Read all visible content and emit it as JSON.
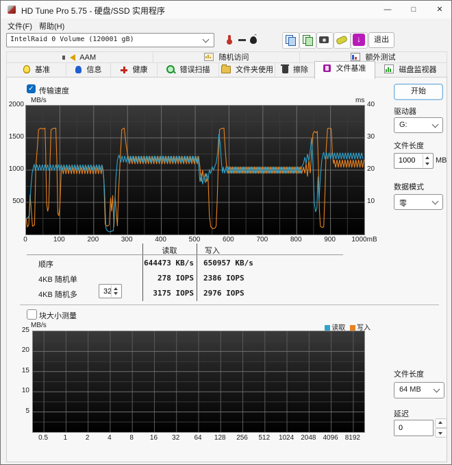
{
  "window": {
    "title": "HD Tune Pro 5.75 - 硬盘/SSD 实用程序",
    "minimize": "—",
    "maximize": "□",
    "close": "✕"
  },
  "menu": {
    "file": "文件(F)",
    "help": "帮助(H)"
  },
  "toolbar": {
    "drive_combo": "IntelRaid 0 Volume (120001 gB)",
    "exit": "退出"
  },
  "tabs": {
    "row1": [
      {
        "label": "AAM"
      },
      {
        "label": "随机访问"
      },
      {
        "label": "额外测试"
      }
    ],
    "row2": [
      {
        "label": "基准"
      },
      {
        "label": "信息"
      },
      {
        "label": "健康"
      },
      {
        "label": "错误扫描"
      },
      {
        "label": "文件夹使用"
      },
      {
        "label": "擦除"
      },
      {
        "label": "文件基准",
        "active": true
      },
      {
        "label": "磁盘监视器"
      }
    ]
  },
  "controls": {
    "transfer_speed": "传输速度",
    "block_size": "块大小测量",
    "check_glyph": "✓",
    "start": "开始",
    "drive_label": "驱动器",
    "drive_value": "G:",
    "file_length_label": "文件长度",
    "file_length_value": "1000",
    "file_length_unit": "MB",
    "data_mode_label": "数据模式",
    "data_mode_value": "零",
    "file_length2_label": "文件长度",
    "file_length2_value": "64 MB",
    "delay_label": "延迟",
    "delay_value": "0",
    "multi_queue_value": "32"
  },
  "results": {
    "read_header": "读取",
    "write_header": "写入",
    "rows": [
      {
        "label": "顺序",
        "read": "644473 KB/s",
        "write": "650957 KB/s"
      },
      {
        "label": "4KB 随机单",
        "read": "278 IOPS",
        "write": "2386 IOPS"
      },
      {
        "label": "4KB 随机多",
        "read": "3175 IOPS",
        "write": "2976 IOPS"
      }
    ]
  },
  "colors": {
    "read": "#2fa3cc",
    "write": "#e8821e"
  },
  "chart_data": [
    {
      "type": "line",
      "title": "传输速度",
      "ylabel": "MB/s",
      "ylabel_right": "ms",
      "xlim": [
        0,
        1000
      ],
      "ylim": [
        0,
        2000
      ],
      "ylim_right": [
        0,
        40
      ],
      "yticks": [
        2000,
        1500,
        1000,
        500
      ],
      "yticks_right": [
        40,
        30,
        20,
        10
      ],
      "xticks": [
        0,
        100,
        200,
        300,
        400,
        500,
        600,
        700,
        800,
        900
      ],
      "xtick_last": "1000mB",
      "grid": {
        "x_minor": 50,
        "x_major": 100,
        "y_minor": 250,
        "y_major": 500
      },
      "series": [
        {
          "name": "写入",
          "color": "#e8821e",
          "segments": [
            {
              "p": [
                [
                  0,
                  260
                ],
                [
                  4,
                  120
                ],
                [
                  8,
                  150
                ],
                [
                  12,
                  620
                ],
                [
                  15,
                  420
                ],
                [
                  19,
                  130
                ],
                [
                  25,
                  150
                ],
                [
                  29,
                  1050
                ],
                [
                  33,
                  1320
                ],
                [
                  37,
                  1630
                ],
                [
                  44,
                  1650
                ],
                [
                  50,
                  1635
                ],
                [
                  56,
                  1650
                ],
                [
                  58,
                  1280
                ],
                [
                  61,
                  480
                ],
                [
                  64,
                  360
                ],
                [
                  67,
                  430
                ],
                [
                  70,
                  1000
                ],
                [
                  74,
                  1630
                ],
                [
                  80,
                  1645
                ],
                [
                  88,
                  1650
                ],
                [
                  91,
                  1150
                ],
                [
                  94,
                  330
                ],
                [
                  97,
                  290
                ],
                [
                  100,
                  430
                ],
                [
                  104,
                  990
                ]
              ]
            },
            {
              "o": [
                106,
                228,
                1000,
                60,
                4
              ]
            },
            {
              "p": [
                [
                  230,
                  870
                ],
                [
                  234,
                  160
                ],
                [
                  240,
                  130
                ],
                [
                  246,
                  150
                ],
                [
                  250,
                  570
                ],
                [
                  253,
                  360
                ],
                [
                  256,
                  610
                ],
                [
                  260,
                  120
                ],
                [
                  263,
                  590
                ],
                [
                  266,
                  410
                ],
                [
                  270,
                  130
                ],
                [
                  274,
                  720
                ],
                [
                  278,
                  1120
                ],
                [
                  283,
                  1630
                ],
                [
                  290,
                  1650
                ],
                [
                  295,
                  1430
                ],
                [
                  300,
                  1240
                ]
              ]
            },
            {
              "o": [
                302,
                512,
                1155,
                60,
                4
              ]
            },
            {
              "p": [
                [
                  514,
                  1050
                ],
                [
                  518,
                  820
                ],
                [
                  522,
                  1000
                ],
                [
                  526,
                  860
                ],
                [
                  530,
                  950
                ],
                [
                  534,
                  820
                ],
                [
                  538,
                  900
                ],
                [
                  542,
                  300
                ],
                [
                  546,
                  120
                ],
                [
                  552,
                  90
                ],
                [
                  558,
                  100
                ],
                [
                  562,
                  130
                ],
                [
                  565,
                  520
                ],
                [
                  568,
                  1050
                ],
                [
                  572,
                  1630
                ],
                [
                  578,
                  1645
                ],
                [
                  585,
                  1650
                ],
                [
                  589,
                  1300
                ],
                [
                  593,
                  1050
                ]
              ]
            },
            {
              "o": [
                595,
                818,
                1000,
                55,
                4
              ]
            },
            {
              "p": [
                [
                  820,
                  1050
                ],
                [
                  824,
                  950
                ],
                [
                  828,
                  1100
                ],
                [
                  832,
                  900
                ],
                [
                  836,
                  1150
                ],
                [
                  840,
                  950
                ],
                [
                  844,
                  1250
                ],
                [
                  848,
                  1560
                ],
                [
                  852,
                  1600
                ],
                [
                  857,
                  1580
                ],
                [
                  861,
                  1600
                ],
                [
                  864,
                  1100
                ],
                [
                  867,
                  400
                ],
                [
                  870,
                  130
                ],
                [
                  875,
                  110
                ],
                [
                  880,
                  120
                ],
                [
                  884,
                  700
                ],
                [
                  887,
                  1300
                ],
                [
                  891,
                  1640
                ],
                [
                  896,
                  1650
                ],
                [
                  902,
                  1640
                ],
                [
                  905,
                  1300
                ],
                [
                  909,
                  1100
                ]
              ]
            },
            {
              "o": [
                911,
                999,
                1100,
                60,
                4
              ]
            }
          ]
        },
        {
          "name": "读取",
          "color": "#2fa3cc",
          "segments": [
            {
              "p": [
                [
                  0,
                  240
                ],
                [
                  5,
                  260
                ],
                [
                  10,
                  300
                ],
                [
                  14,
                  700
                ],
                [
                  18,
                  950
                ],
                [
                  22,
                  1050
                ]
              ]
            },
            {
              "o": [
                24,
                226,
                1040,
                45,
                4
              ]
            },
            {
              "p": [
                [
                  228,
                  1000
                ],
                [
                  232,
                  700
                ],
                [
                  236,
                  100
                ],
                [
                  240,
                  60
                ],
                [
                  246,
                  40
                ],
                [
                  252,
                  50
                ],
                [
                  258,
                  60
                ],
                [
                  262,
                  400
                ],
                [
                  266,
                  900
                ],
                [
                  270,
                  1150
                ],
                [
                  274,
                  1230
                ]
              ]
            },
            {
              "o": [
                276,
                508,
                1170,
                50,
                4
              ]
            },
            {
              "p": [
                [
                  510,
                  1100
                ],
                [
                  514,
                  820
                ],
                [
                  518,
                  950
                ],
                [
                  522,
                  780
                ],
                [
                  526,
                  900
                ],
                [
                  530,
                  800
                ],
                [
                  534,
                  950
                ],
                [
                  538,
                  850
                ],
                [
                  542,
                  1000
                ],
                [
                  546,
                  950
                ],
                [
                  550,
                  1050
                ],
                [
                  554,
                  1000
                ],
                [
                  558,
                  1060
                ],
                [
                  562,
                  1110
                ],
                [
                  566,
                  1250
                ],
                [
                  570,
                  1560
                ],
                [
                  574,
                  1400
                ],
                [
                  578,
                  1100
                ],
                [
                  581,
                  950
                ]
              ]
            },
            {
              "o": [
                583,
                818,
                1000,
                50,
                4
              ]
            },
            {
              "p": [
                [
                  820,
                  1100
                ],
                [
                  824,
                  1200
                ],
                [
                  828,
                  1100
                ],
                [
                  832,
                  1250
                ],
                [
                  836,
                  1150
                ],
                [
                  840,
                  1300
                ],
                [
                  844,
                  1500
                ],
                [
                  848,
                  1100
                ],
                [
                  852,
                  500
                ],
                [
                  856,
                  350
                ],
                [
                  860,
                  420
                ],
                [
                  863,
                  900
                ],
                [
                  866,
                  520
                ],
                [
                  870,
                  900
                ],
                [
                  874,
                  1150
                ],
                [
                  878,
                  1250
                ]
              ]
            },
            {
              "o": [
                880,
                999,
                1220,
                50,
                4
              ]
            }
          ]
        }
      ]
    },
    {
      "type": "line",
      "title": "块大小测量",
      "ylabel": "MB/s",
      "ylim": [
        0,
        25
      ],
      "yticks": [
        25,
        20,
        15,
        10,
        5
      ],
      "xticks": [
        "0.5",
        "1",
        "2",
        "4",
        "8",
        "16",
        "32",
        "64",
        "128",
        "256",
        "512",
        "1024",
        "2048",
        "4096",
        "8192"
      ],
      "grid": {
        "y_minor": 2.5,
        "y_major": 5,
        "x_grid": "per-tick"
      },
      "legend": [
        {
          "name": "读取",
          "color": "#2fa3cc"
        },
        {
          "name": "写入",
          "color": "#e8821e"
        }
      ],
      "series": []
    }
  ]
}
